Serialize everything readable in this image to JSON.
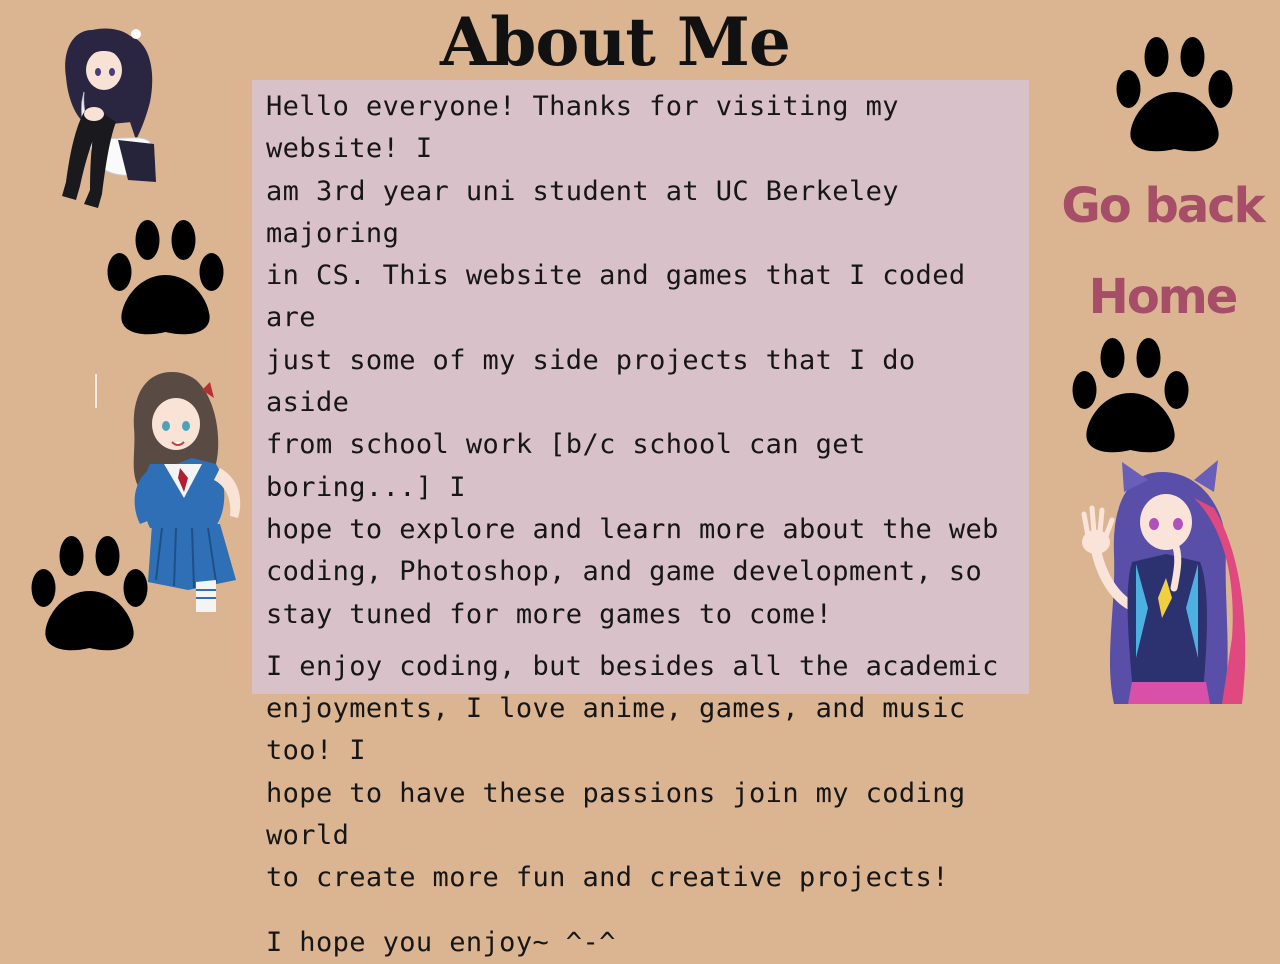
{
  "page": {
    "title": "About Me"
  },
  "content": {
    "paragraphs": [
      "Hello everyone! Thanks for visiting my website! I\nam 3rd year uni student at UC Berkeley majoring\nin CS. This website and games that I coded are\njust some of my side projects that I do aside\nfrom school work [b/c school can get boring...] I\nhope to explore and learn more about the web\ncoding, Photoshop, and game development, so\nstay tuned for more games to come!",
      "I enjoy coding, but besides all the academic\nenjoyments, I love anime, games, and music too! I\nhope to have these passions join my coding world\nto create more fun and creative projects!",
      "I hope you enjoy~ ^-^"
    ]
  },
  "nav": {
    "go_back_label": "Go back",
    "home_label": "Home"
  },
  "colors": {
    "background": "#dbb591",
    "panel": "#d8c1c9",
    "nav_text": "#a64e68",
    "paw": "#000000"
  },
  "decorations": {
    "paw_icon": "paw-print-icon",
    "characters": [
      "anime-girl-sitting",
      "anime-girl-schoolgirl",
      "anime-girl-cat-ears"
    ]
  }
}
